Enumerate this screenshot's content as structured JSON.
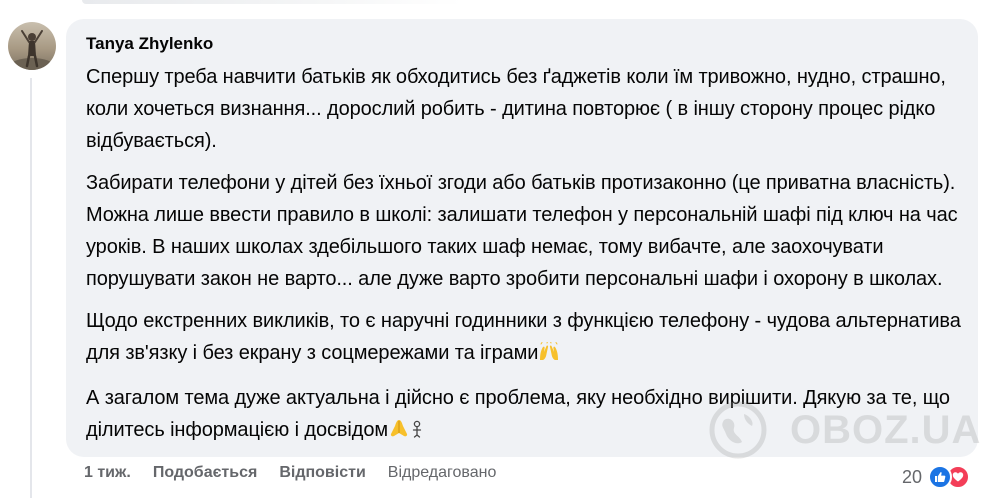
{
  "comment": {
    "author": "Tanya Zhylenko",
    "paragraphs": [
      "Спершу треба навчити батьків як обходитись без ґаджетів коли їм тривожно, нудно, страшно, коли хочеться визнання... дорослий робить - дитина повторює ( в іншу сторону процес рідко відбувається).",
      "Забирати телефони у дітей без їхньої згоди або батьків протизаконно (це приватна власність). Можна лише ввести правило в школі: залишати телефон у персональній шафі під ключ на час уроків. В наших школах здебільшого таких шаф немає, тому вибачте, але заохочувати порушувати закон не варто... але дуже варто зробити персональні шафи і охорону в школах.",
      "Щодо екстренних викликів, то є наручні годинники з функцією телефону - чудова альтернатива для зв'язку і без екрану з соцмережами та іграми",
      "А загалом тема дуже актуальна і дійсно є проблема, яку необхідно вирішити. Дякую за те, що ділитесь інформацією і досвідом"
    ]
  },
  "actions": {
    "time": "1 тиж.",
    "like": "Подобається",
    "reply": "Відповісти",
    "edited": "Відредаговано"
  },
  "reactions": {
    "count": "20",
    "types": [
      "like-icon",
      "love-icon"
    ]
  },
  "watermark": "OBOZ.UA",
  "colors": {
    "bubble": "#f0f2f5",
    "text": "#050505",
    "secondary": "#65676b",
    "like": "#1b74e4",
    "love": "#f33e58"
  }
}
